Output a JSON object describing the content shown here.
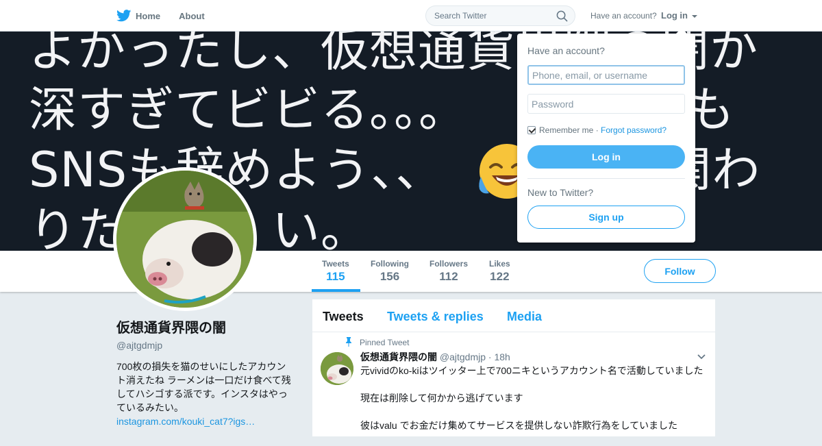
{
  "topbar": {
    "logo_icon": "twitter-bird-icon",
    "brand_color": "#1da1f2",
    "home_label": "Home",
    "about_label": "About",
    "search_placeholder": "Search Twitter",
    "have_account": "Have an account?",
    "login_label": "Log in"
  },
  "banner": {
    "text": "よかったし、仮想通貨界隈の闇か\n深すぎてビビる。。。　　　　　も\nSNSも辞めよう、、　　　　　関わ\nりた　　　い。",
    "emoji": "face-with-tears-of-joy"
  },
  "profile": {
    "name": "仮想通貨界隈の闇",
    "handle": "@ajtgdmjp",
    "bio": "700枚の損失を猫のせいにしたアカウント消えたね ラーメンは一口だけ食べて残してハシゴする派です。インスタはやっているみたい。",
    "bio_link": "instagram.com/kouki_cat7?igs…"
  },
  "stats": [
    {
      "label": "Tweets",
      "value": "115"
    },
    {
      "label": "Following",
      "value": "156"
    },
    {
      "label": "Followers",
      "value": "112"
    },
    {
      "label": "Likes",
      "value": "122"
    }
  ],
  "follow_label": "Follow",
  "timeline": {
    "tabs": [
      "Tweets",
      "Tweets & replies",
      "Media"
    ],
    "pinned_label": "Pinned Tweet",
    "tweet": {
      "name": "仮想通貨界隈の闇",
      "handle": "@ajtgdmjp",
      "time": "18h",
      "lines": [
        "元vividのko-kiはツイッター上で700ニキというアカウント名で活動していました",
        "現在は削除して何かから逃げています",
        "彼はvalu でお金だけ集めてサービスを提供しない詐欺行為をしていました"
      ]
    }
  },
  "login_dropdown": {
    "title": "Have an account?",
    "username_placeholder": "Phone, email, or username",
    "password_placeholder": "Password",
    "remember_label": "Remember me",
    "separator": " · ",
    "forgot_label": "Forgot password?",
    "login_button": "Log in",
    "new_label": "New to Twitter?",
    "signup_button": "Sign up"
  }
}
